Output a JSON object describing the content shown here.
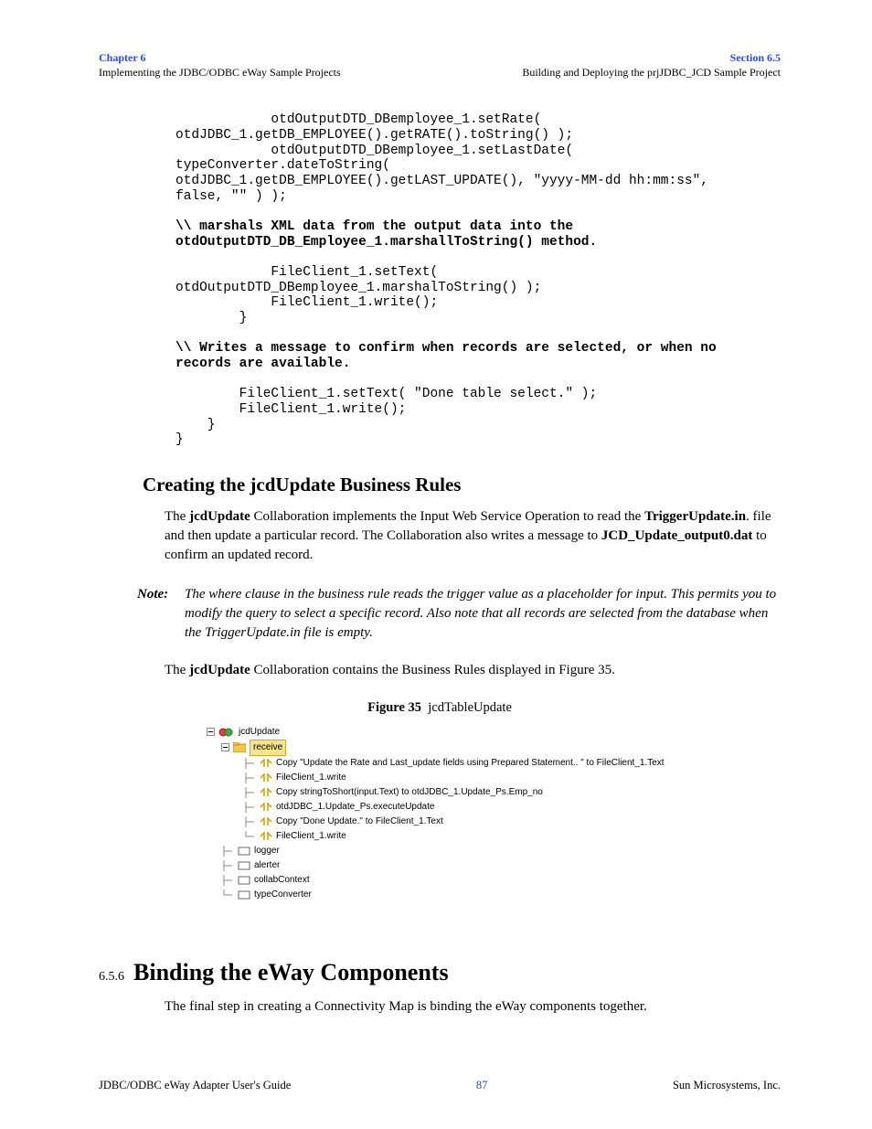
{
  "header": {
    "chapter_label": "Chapter 6",
    "chapter_sub": "Implementing the JDBC/ODBC eWay Sample Projects",
    "section_label": "Section 6.5",
    "section_sub": "Building and Deploying the prjJDBC_JCD Sample Project"
  },
  "code": {
    "block1_l1": "            otdOutputDTD_DBemployee_1.setRate( ",
    "block1_l2": "otdJDBC_1.getDB_EMPLOYEE().getRATE().toString() );",
    "block1_l3": "            otdOutputDTD_DBemployee_1.setLastDate( ",
    "block1_l4": "typeConverter.dateToString( ",
    "block1_l5": "otdJDBC_1.getDB_EMPLOYEE().getLAST_UPDATE(), \"yyyy-MM-dd hh:mm:ss\", ",
    "block1_l6": "false, \"\" ) );",
    "comment1_l1": "\\\\ marshals XML data from the output data into the ",
    "comment1_l2": "otdOutputDTD_DB_Employee_1.marshallToString() method.",
    "block2_l1": "            FileClient_1.setText( ",
    "block2_l2": "otdOutputDTD_DBemployee_1.marshalToString() );",
    "block2_l3": "            FileClient_1.write();",
    "block2_l4": "        }",
    "comment2_l1": "\\\\ Writes a message to confirm when records are selected, or when no ",
    "comment2_l2": "records are available.",
    "block3_l1": "        FileClient_1.setText( \"Done table select.\" );",
    "block3_l2": "        FileClient_1.write();",
    "block3_l3": "    }",
    "block3_l4": "}"
  },
  "h2": "Creating the jcdUpdate Business Rules",
  "para1": {
    "pre1": "The ",
    "b1": "jcdUpdate",
    "mid1": " Collaboration implements the Input Web Service Operation to read the ",
    "b2": "TriggerUpdate.in",
    "mid2": ". file and then update a particular record. The Collaboration also writes a message to ",
    "b3": "JCD_Update_output0.dat",
    "end": " to confirm an updated record."
  },
  "note": {
    "label": "Note:",
    "body": "The where clause in the business rule reads the trigger value as a placeholder for input. This permits you to modify the query to select a specific record. Also note that all records are selected from the database when the TriggerUpdate.in file is empty."
  },
  "para2": {
    "pre": "The ",
    "b1": "jcdUpdate",
    "end": " Collaboration contains the Business Rules displayed in Figure 35."
  },
  "figure": {
    "label": "Figure 35",
    "title": "jcdTableUpdate",
    "root": "jcdUpdate",
    "receive": "receive",
    "items": [
      "Copy \"Update the Rate and Last_update fields using Prepared Statement.. \" to FileClient_1.Text",
      "FileClient_1.write",
      "Copy stringToShort(input.Text) to otdJDBC_1.Update_Ps.Emp_no",
      "otdJDBC_1.Update_Ps.executeUpdate",
      "Copy \"Done Update.\" to FileClient_1.Text",
      "FileClient_1.write"
    ],
    "tail": [
      "logger",
      "alerter",
      "collabContext",
      "typeConverter"
    ]
  },
  "section": {
    "number": "6.5.6",
    "title": "Binding the eWay Components",
    "body": "The final step in creating a Connectivity Map is binding the eWay components together."
  },
  "footer": {
    "left": "JDBC/ODBC eWay Adapter User's Guide",
    "center": "87",
    "right": "Sun Microsystems, Inc."
  }
}
